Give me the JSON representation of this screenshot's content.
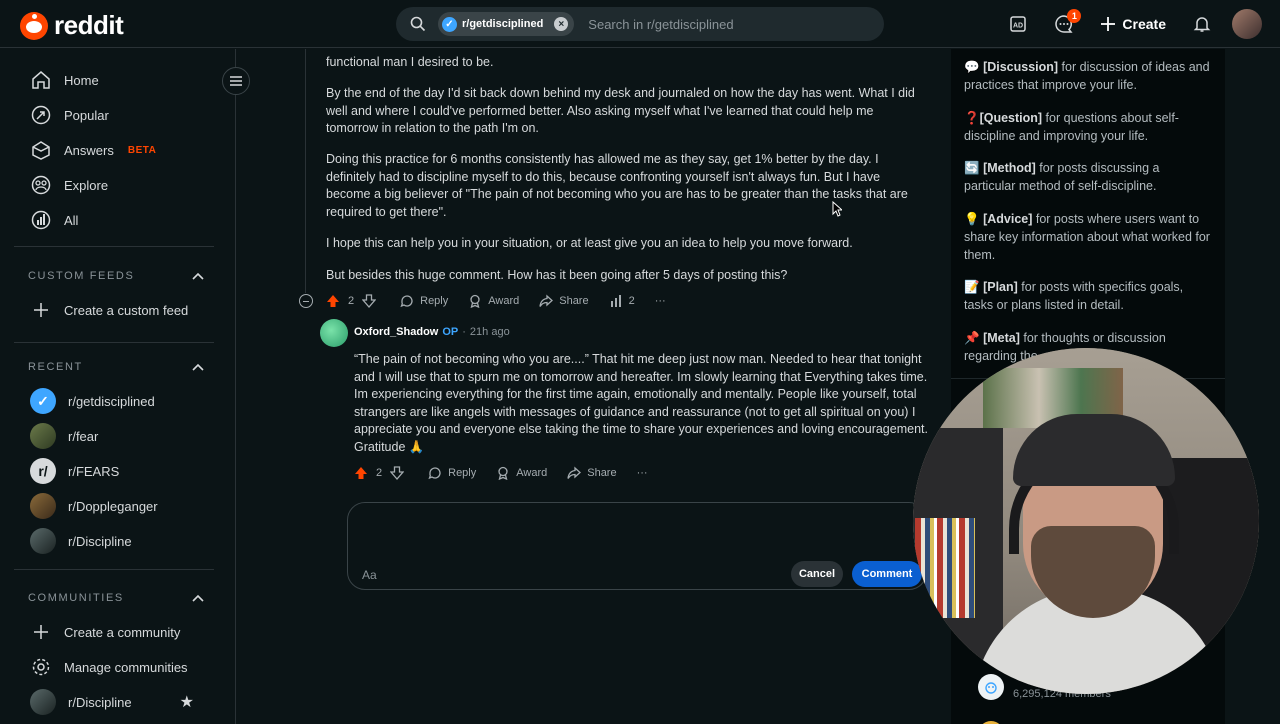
{
  "header": {
    "logo_text": "reddit",
    "search_chip": "r/getdisciplined",
    "search_placeholder": "Search in r/getdisciplined",
    "chat_badge": "1",
    "create_label": "Create"
  },
  "sidebar": {
    "nav": [
      {
        "label": "Home",
        "icon": "home-icon"
      },
      {
        "label": "Popular",
        "icon": "popular-icon"
      },
      {
        "label": "Answers",
        "icon": "answers-icon",
        "badge": "BETA"
      },
      {
        "label": "Explore",
        "icon": "explore-icon"
      },
      {
        "label": "All",
        "icon": "all-icon"
      }
    ],
    "custom_feeds_title": "CUSTOM FEEDS",
    "create_custom_feed": "Create a custom feed",
    "recent_title": "RECENT",
    "recent": [
      "r/getdisciplined",
      "r/fear",
      "r/FEARS",
      "r/Doppleganger",
      "r/Discipline"
    ],
    "communities_title": "COMMUNITIES",
    "create_community": "Create a community",
    "manage_communities": "Manage communities",
    "community_item": "r/Discipline"
  },
  "comment": {
    "p0": "functional man I desired to be.",
    "p1": "By the end of the day I'd sit back down behind my desk and journaled on how the day has went. What I did well and where I could've performed better. Also asking myself what I've learned that could help me tomorrow in relation to the path I'm on.",
    "p2": "Doing this practice for 6 months consistently has allowed me as they say, get 1% better by the day. I definitely had to discipline myself to do this, because confronting yourself isn't always fun. But I have become a big believer of \"The pain of not becoming who you are has to be greater than the tasks that are required to get there\".",
    "p3": "I hope this can help you in your situation, or at least give you an idea to help you move forward.",
    "p4": "But besides this huge comment. How has it been going after 5 days of posting this?",
    "votes": "2",
    "reply": "Reply",
    "award": "Award",
    "share": "Share",
    "insights": "2"
  },
  "reply": {
    "username": "Oxford_Shadow",
    "op": "OP",
    "sep": "·",
    "time": "21h ago",
    "text": "“The pain of not becoming who you are....” That hit me deep just now man. Needed to hear that tonight and I will use that to spurn me on tomorrow and hereafter. Im slowly learning that Everything takes time. Im experiencing everything for the first time again, emotionally and mentally. People like yourself, total strangers are like angels with messages of guidance and reassurance (not to get all spiritual on you) I appreciate you and everyone else taking the time to share your experiences and loving encouragement. Gratitude 🙏",
    "votes": "2",
    "reply": "Reply",
    "award": "Award",
    "share": "Share"
  },
  "composer": {
    "format": "Aa",
    "cancel": "Cancel",
    "submit": "Comment"
  },
  "rules": [
    {
      "emoji": "💬",
      "tag": "[Discussion]",
      "text": " for discussion of ideas and practices that improve your life."
    },
    {
      "emoji": "❓",
      "tag": "[Question]",
      "text": " for questions about self-discipline and improving your life."
    },
    {
      "emoji": "🔄",
      "tag": "[Method]",
      "text": " for posts discussing a particular method of self-discipline."
    },
    {
      "emoji": "💡",
      "tag": "[Advice]",
      "text": " for posts where users want to share key information about what worked for them."
    },
    {
      "emoji": "📝",
      "tag": "[Plan]",
      "text": " for posts with specifics goals, tasks or plans listed in detail."
    },
    {
      "emoji": "📌",
      "tag": "[Meta]",
      "text": " for thoughts or discussion regarding the"
    }
  ],
  "members": "6,295,124 members",
  "colors": {
    "accent": "#ff4500",
    "link": "#3ea6ff",
    "button": "#0a5fd1",
    "background": "#0b1416"
  }
}
